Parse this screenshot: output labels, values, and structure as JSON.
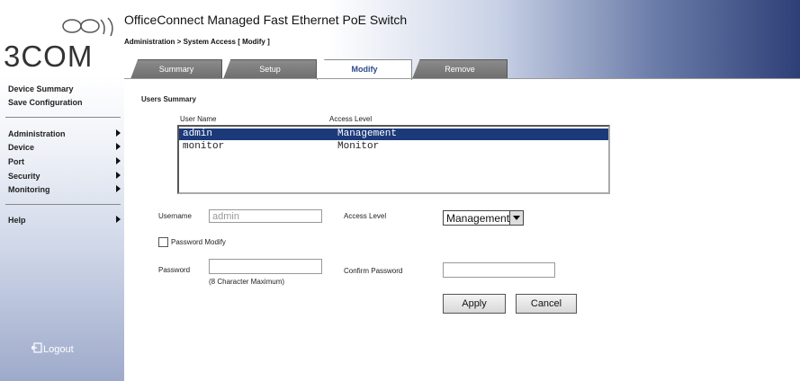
{
  "brand": {
    "logo_text": "3COM"
  },
  "header": {
    "title": "OfficeConnect Managed Fast Ethernet PoE Switch",
    "breadcrumb": "Administration > System Access [ Modify ]"
  },
  "sidebar": {
    "links": [
      {
        "label": "Device Summary"
      },
      {
        "label": "Save Configuration"
      }
    ],
    "menu": [
      {
        "label": "Administration"
      },
      {
        "label": "Device"
      },
      {
        "label": "Port"
      },
      {
        "label": "Security"
      },
      {
        "label": "Monitoring"
      }
    ],
    "help": "Help",
    "logout": "Logout"
  },
  "tabs": [
    {
      "label": "Summary",
      "active": false
    },
    {
      "label": "Setup",
      "active": false
    },
    {
      "label": "Modify",
      "active": true
    },
    {
      "label": "Remove",
      "active": false
    }
  ],
  "users_summary": {
    "heading": "Users Summary",
    "columns": [
      "User Name",
      "Access Level"
    ],
    "rows": [
      {
        "user": "admin",
        "level": "Management",
        "selected": true
      },
      {
        "user": "monitor",
        "level": "Monitor",
        "selected": false
      }
    ]
  },
  "form": {
    "username_label": "Username",
    "username_value": "admin",
    "access_level_label": "Access Level",
    "access_level_value": "Management",
    "password_modify_label": "Password Modify",
    "password_label": "Password",
    "password_hint": "(8 Character Maximum)",
    "confirm_password_label": "Confirm Password"
  },
  "buttons": {
    "apply": "Apply",
    "cancel": "Cancel"
  },
  "colors": {
    "selected_row": "#1c3a7a",
    "header_dark": "#2d3f77"
  }
}
